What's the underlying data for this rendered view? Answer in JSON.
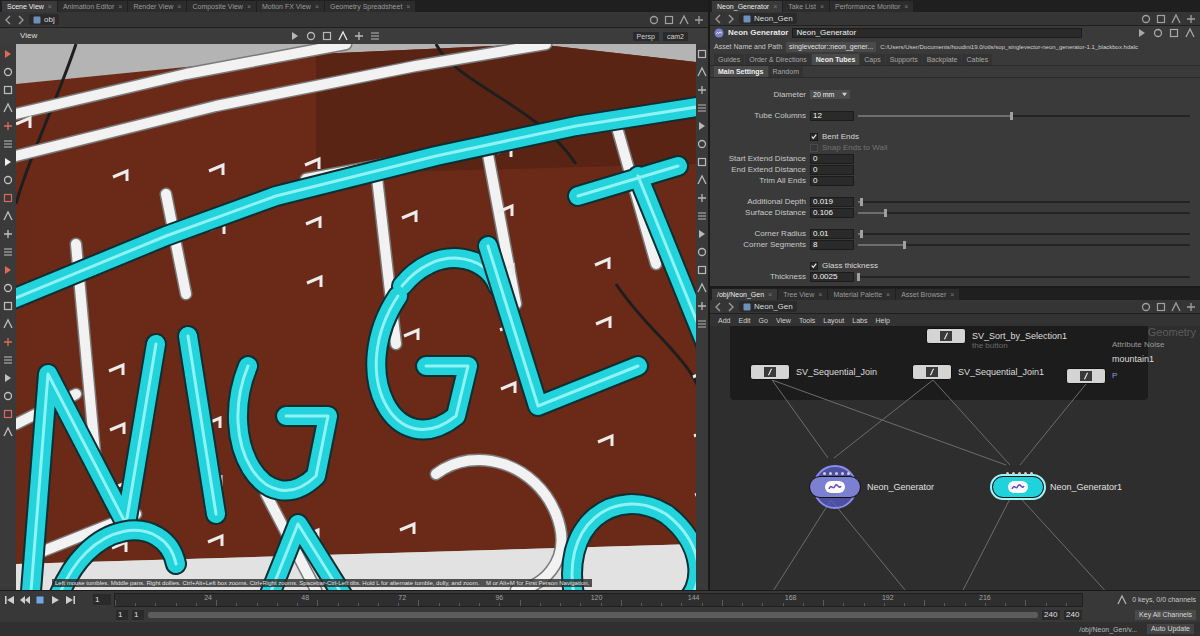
{
  "close_glyph": "×",
  "left_pane": {
    "tabs": [
      {
        "label": "Scene View",
        "selected": true
      },
      {
        "label": "Animation Editor",
        "selected": false
      },
      {
        "label": "Render View",
        "selected": false
      },
      {
        "label": "Composite View",
        "selected": false
      },
      {
        "label": "Motion FX View",
        "selected": false
      },
      {
        "label": "Geometry Spreadsheet",
        "selected": false
      }
    ],
    "path": "obj",
    "view_label": "View",
    "projection": "Persp",
    "camera": "cam2",
    "hint": "Left mouse tumbles. Middle pans. Right dollies. Ctrl+Alt+Left box zooms. Ctrl+Right zooms. Spacebar-Ctrl-Left tilts. Hold L for alternate tumble, dolly, and zoom.    M or Alt+M for First Person Navigation."
  },
  "param_pane": {
    "tabs": [
      {
        "label": "Neon_Generator",
        "selected": true
      },
      {
        "label": "Take List",
        "selected": false
      },
      {
        "label": "Performance Monitor",
        "selected": false
      }
    ],
    "path": "Neon_Gen",
    "node_type": "Neon Generator",
    "node_name": "Neon_Generator",
    "asset_label": "Asset Name and Path",
    "asset_name": "singlevector::neon_gener...",
    "asset_file": "C:/Users/User/Documents/houdini19.0/otls/sop_singlevector-neon_generator-1.1_blackbox.hdalc",
    "folders": [
      {
        "label": "Guides",
        "selected": false
      },
      {
        "label": "Order & Directions",
        "selected": false
      },
      {
        "label": "Neon Tubes",
        "selected": true
      },
      {
        "label": "Caps",
        "selected": false
      },
      {
        "label": "Supports",
        "selected": false
      },
      {
        "label": "Backplate",
        "selected": false
      },
      {
        "label": "Cables",
        "selected": false
      }
    ],
    "subfolders": [
      {
        "label": "Main Settings",
        "selected": true
      },
      {
        "label": "Random",
        "selected": false
      }
    ],
    "parms": [
      {
        "kind": "dropdown",
        "label": "Diameter",
        "value": "20 mm"
      },
      {
        "kind": "separator"
      },
      {
        "kind": "slider",
        "label": "Tube Columns",
        "value": "12",
        "level": 0.46
      },
      {
        "kind": "separator"
      },
      {
        "kind": "checkbox",
        "label": "Bent Ends",
        "checked": true,
        "disabled": false
      },
      {
        "kind": "checkbox",
        "label": "Snap Ends to Wall",
        "checked": false,
        "disabled": true
      },
      {
        "kind": "field",
        "label": "Start Extend Distance",
        "value": "0"
      },
      {
        "kind": "field",
        "label": "End Extend Distance",
        "value": "0"
      },
      {
        "kind": "field",
        "label": "Trim All Ends",
        "value": "0"
      },
      {
        "kind": "separator"
      },
      {
        "kind": "slider",
        "label": "Additional Depth",
        "value": "0.019",
        "level": 0.01
      },
      {
        "kind": "slider",
        "label": "Surface Distance",
        "value": "0.106",
        "level": 0.08
      },
      {
        "kind": "separator"
      },
      {
        "kind": "slider",
        "label": "Corner Radius",
        "value": "0.01",
        "level": 0.01
      },
      {
        "kind": "slider",
        "label": "Corner Segments",
        "value": "8",
        "level": 0.14
      },
      {
        "kind": "separator"
      },
      {
        "kind": "checkbox",
        "label": "Glass thickness",
        "checked": true,
        "disabled": false
      },
      {
        "kind": "slider",
        "label": "Thickness",
        "value": "0.0025",
        "level": 0.0
      }
    ]
  },
  "network_pane": {
    "tabs": [
      {
        "label": "/obj/Neon_Gen",
        "selected": true
      },
      {
        "label": "Tree View",
        "selected": false
      },
      {
        "label": "Material Palette",
        "selected": false
      },
      {
        "label": "Asset Browser",
        "selected": false
      }
    ],
    "path": "Neon_Gen",
    "menu": [
      "Add",
      "Edit",
      "Go",
      "View",
      "Tools",
      "Layout",
      "Labs",
      "Help"
    ],
    "watermark": "Geometry",
    "nodes": [
      {
        "label": "SV_Sort_by_Selection1",
        "comment": "the button",
        "kind": "box",
        "color": "#d4d4d4",
        "selected": false,
        "display": false
      },
      {
        "label": "SV_Sequential_Join",
        "kind": "box",
        "color": "#d4d4d4",
        "selected": false,
        "display": false
      },
      {
        "label": "SV_Sequential_Join1",
        "kind": "box",
        "color": "#d4d4d4",
        "selected": false,
        "display": false
      },
      {
        "label": "mountain1",
        "type": "Attribute Noise",
        "extra": "P",
        "kind": "box",
        "color": "#d4d4d4",
        "selected": false,
        "display": false
      },
      {
        "label": "Neon_Generator",
        "kind": "neon",
        "color": "#7c80d0",
        "selected": true,
        "display": false
      },
      {
        "label": "Neon_Generator1",
        "kind": "neon",
        "color": "#1fd3dd",
        "selected": false,
        "display": true
      }
    ]
  },
  "timeline": {
    "frame": "1",
    "ticks": [
      "24",
      "48",
      "72",
      "96",
      "120",
      "144",
      "168",
      "192",
      "216"
    ],
    "start": "1",
    "range_start": "1",
    "range_end": "240",
    "end": "240",
    "range_level": 1,
    "keys": "0 keys, 0/0 channels",
    "key_all": "Key All Channels",
    "status_path": "/obj/Neon_Gen/v...",
    "auto_update": "Auto Update"
  }
}
